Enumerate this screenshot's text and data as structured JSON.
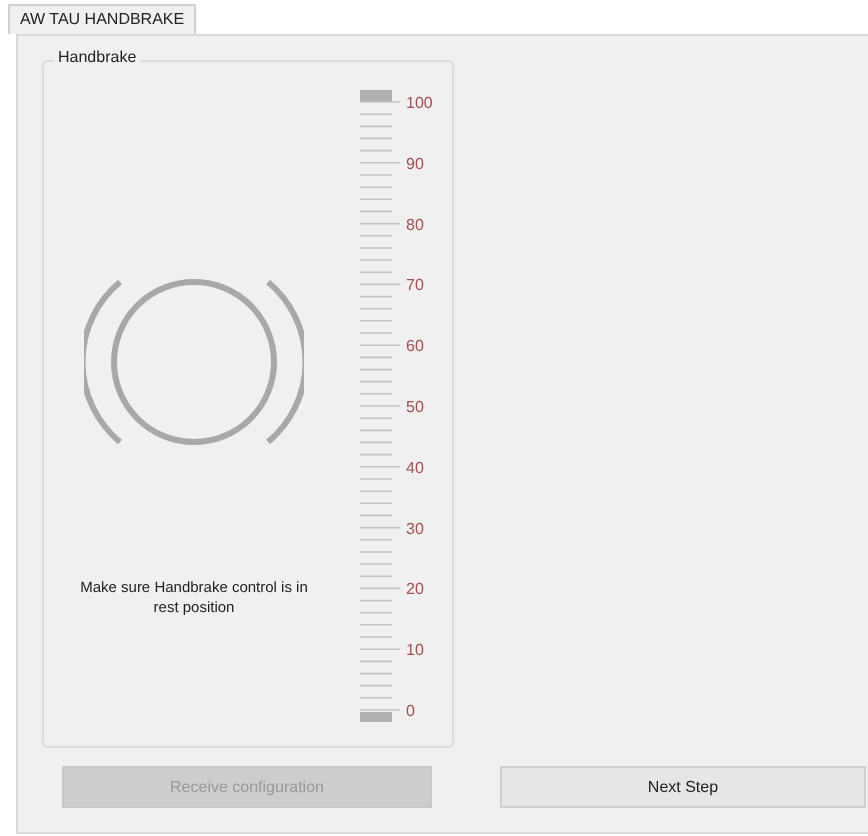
{
  "tabs": [
    {
      "label": "AW TAU HANDBRAKE",
      "selected": true
    }
  ],
  "group": {
    "title": "Handbrake",
    "message": "Make sure Handbrake control is in rest position",
    "scale_labels": [
      "100",
      "90",
      "80",
      "70",
      "60",
      "50",
      "40",
      "30",
      "20",
      "10",
      "0"
    ]
  },
  "buttons": [
    {
      "label": "Receive configuration",
      "disabled": true
    },
    {
      "label": "Next Step",
      "disabled": false
    }
  ]
}
